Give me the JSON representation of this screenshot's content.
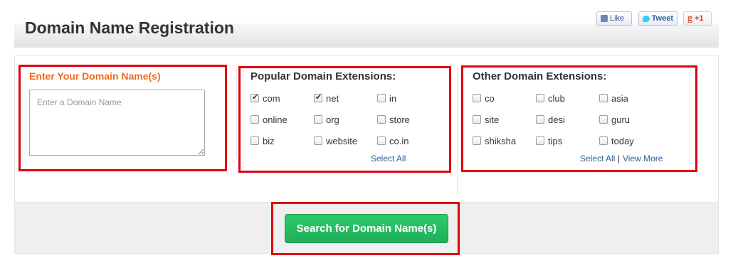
{
  "header": {
    "title": "Domain Name Registration"
  },
  "social": {
    "like": "Like",
    "tweet": "Tweet",
    "gplus": "+1"
  },
  "input_section": {
    "title": "Enter Your Domain Name(s)",
    "placeholder": "Enter a Domain Name",
    "value": ""
  },
  "popular": {
    "title": "Popular Domain Extensions:",
    "items": [
      {
        "label": "com",
        "checked": true
      },
      {
        "label": "net",
        "checked": true
      },
      {
        "label": "in",
        "checked": false
      },
      {
        "label": "online",
        "checked": false
      },
      {
        "label": "org",
        "checked": false
      },
      {
        "label": "store",
        "checked": false
      },
      {
        "label": "biz",
        "checked": false
      },
      {
        "label": "website",
        "checked": false
      },
      {
        "label": "co.in",
        "checked": false
      }
    ],
    "select_all": "Select All"
  },
  "other": {
    "title": "Other Domain Extensions:",
    "items": [
      {
        "label": "co",
        "checked": false
      },
      {
        "label": "club",
        "checked": false
      },
      {
        "label": "asia",
        "checked": false
      },
      {
        "label": "site",
        "checked": false
      },
      {
        "label": "desi",
        "checked": false
      },
      {
        "label": "guru",
        "checked": false
      },
      {
        "label": "shiksha",
        "checked": false
      },
      {
        "label": "tips",
        "checked": false
      },
      {
        "label": "today",
        "checked": false
      }
    ],
    "select_all": "Select All",
    "separator": "|",
    "view_more": "View More"
  },
  "search_button": "Search for Domain Name(s)",
  "colors": {
    "highlight": "#e0000f",
    "accent_orange": "#f26b1d",
    "button_green": "#22b45e",
    "link": "#2a5e98"
  }
}
